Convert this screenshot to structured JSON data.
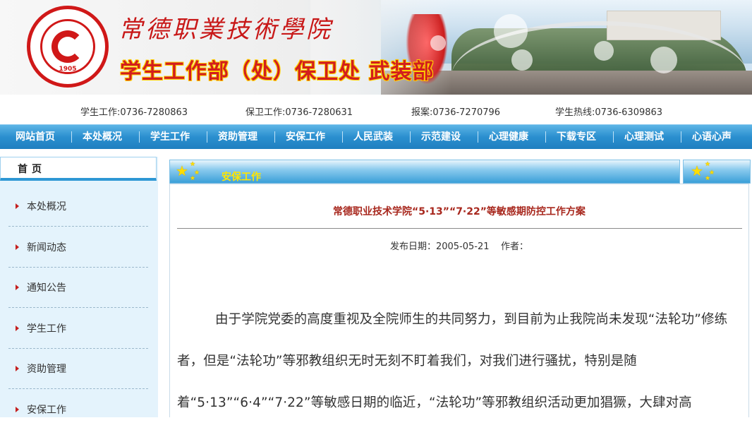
{
  "banner": {
    "school_name": "常德职業技術學院",
    "dept_name": "学生工作部（处）保卫处 武装部",
    "logo_year": "1905"
  },
  "contacts": [
    {
      "label": "学生工作:0736-7280863"
    },
    {
      "label": "保卫工作:0736-7280631"
    },
    {
      "label": "报案:0736-7270796"
    },
    {
      "label": "学生热线:0736-6309863"
    }
  ],
  "nav": [
    {
      "label": "网站首页"
    },
    {
      "label": "本处概况"
    },
    {
      "label": "学生工作"
    },
    {
      "label": "资助管理"
    },
    {
      "label": "安保工作"
    },
    {
      "label": "人民武装"
    },
    {
      "label": "示范建设"
    },
    {
      "label": "心理健康"
    },
    {
      "label": "下载专区"
    },
    {
      "label": "心理测试"
    },
    {
      "label": "心语心声"
    }
  ],
  "sidebar": {
    "home_label": "首页",
    "items": [
      {
        "label": "本处概况"
      },
      {
        "label": "新闻动态"
      },
      {
        "label": "通知公告"
      },
      {
        "label": "学生工作"
      },
      {
        "label": "资助管理"
      },
      {
        "label": "安保工作"
      }
    ]
  },
  "main": {
    "section_title": "安保工作",
    "article": {
      "title": "常德职业技术学院“5·13”“7·22”等敏感期防控工作方案",
      "meta": "发布日期：2005-05-21    作者：",
      "body": "由于学院党委的高度重视及全院师生的共同努力，到目前为止我院尚未发现“法轮功”修练者，但是“法轮功”等邪教组织无时无刻不盯着我们，对我们进行骚扰，特别是随着“5·13”“6·4”“7·22”等敏感日期的临近，“法轮功”等邪教组织活动更加猖獗，大肆对高"
    }
  },
  "colors": {
    "nav_blue": "#2a8fcf",
    "title_red": "#a8281e",
    "section_yellow": "#ffe600",
    "side_bg": "#e4f3fc"
  }
}
